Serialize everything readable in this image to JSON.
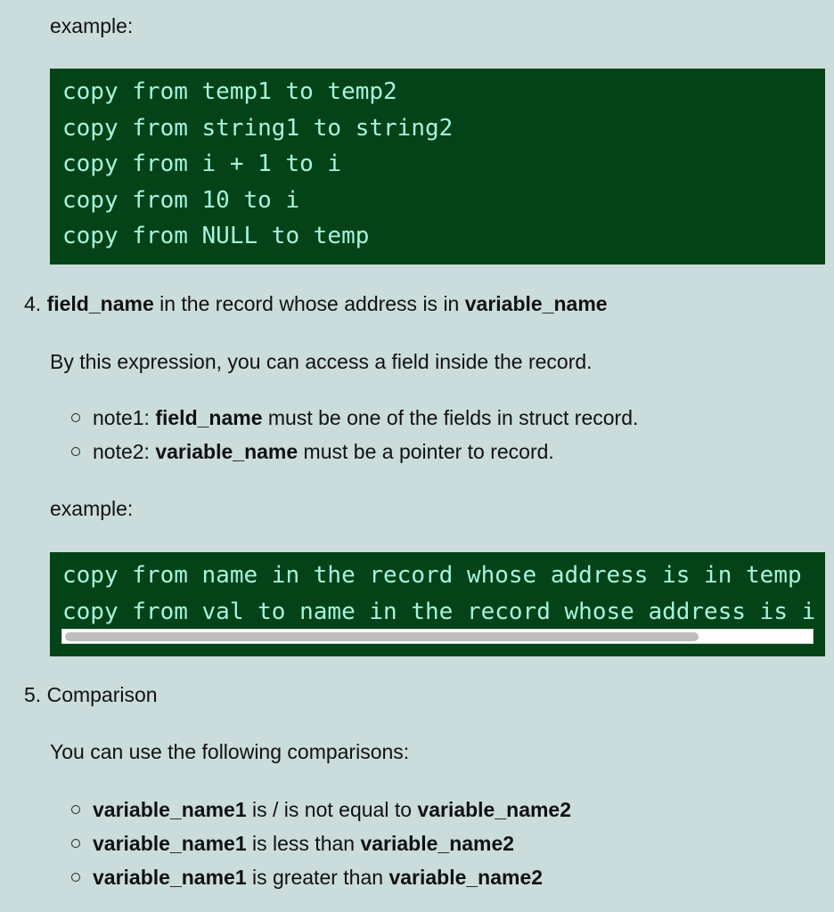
{
  "section3": {
    "example_label": "example:",
    "code_lines": [
      "copy from temp1 to temp2",
      "copy from string1 to string2",
      "copy from i + 1 to i",
      "copy from 10 to i",
      "copy from NULL to temp"
    ]
  },
  "section4": {
    "number": "4.",
    "title_bold1": "field_name",
    "title_mid": " in the record whose address is in ",
    "title_bold2": "variable_name",
    "description": "By this expression, you can access a field inside the record.",
    "notes": [
      {
        "prefix": "note1: ",
        "bold": "field_name",
        "suffix": " must be one of the fields in struct record."
      },
      {
        "prefix": "note2: ",
        "bold": "variable_name",
        "suffix": " must be a pointer to record."
      }
    ],
    "example_label": "example:",
    "code_lines": [
      "copy from name in the record whose address is in temp to val",
      "copy from val to name in the record whose address is in temp"
    ],
    "scroll_position_fraction": 0.0,
    "scroll_visible_fraction": 0.85
  },
  "section5": {
    "number": "5.",
    "title": "Comparison",
    "description": "You can use the following comparisons:",
    "items": [
      {
        "bold1": "variable_name1",
        "mid": " is / is not equal to ",
        "bold2": "variable_name2"
      },
      {
        "bold1": "variable_name1",
        "mid": " is less than ",
        "bold2": "variable_name2"
      },
      {
        "bold1": "variable_name1",
        "mid": " is greater than ",
        "bold2": "variable_name2"
      }
    ]
  },
  "colors": {
    "page_background": "#cbdcdc",
    "code_background": "#044317",
    "code_text": "#a6f4e0"
  }
}
